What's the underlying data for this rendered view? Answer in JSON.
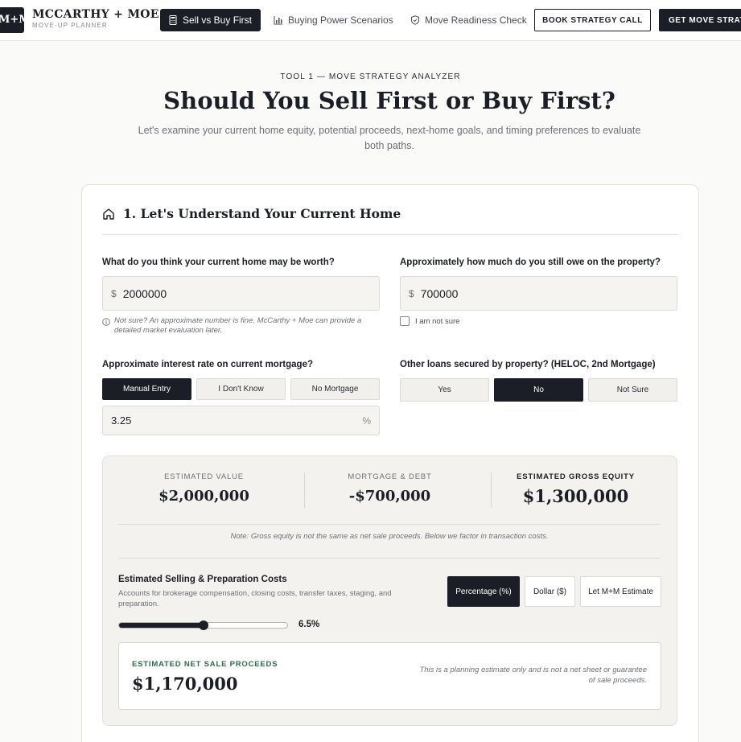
{
  "nav": {
    "logo_mark": "M+M",
    "brand_name": "MCCARTHY + MOE",
    "brand_sub": "MOVE-UP PLANNER",
    "tabs": [
      {
        "label": "Sell vs Buy First",
        "icon": "calculator-icon",
        "active": true
      },
      {
        "label": "Buying Power Scenarios",
        "icon": "bar-chart-icon",
        "active": false
      },
      {
        "label": "Move Readiness Check",
        "icon": "shield-check-icon",
        "active": false
      }
    ],
    "book_call": "BOOK STRATEGY CALL",
    "get_strategy": "GET MOVE STRATEGY"
  },
  "hero": {
    "eyebrow": "TOOL 1 — MOVE STRATEGY ANALYZER",
    "title": "Should You Sell First or Buy First?",
    "subtitle": "Let's examine your current home equity, potential proceeds, next-home goals, and timing preferences to evaluate both paths."
  },
  "section": {
    "title": "1. Let's Understand Your Current Home",
    "home_value": {
      "label": "What do you think your current home may be worth?",
      "currency": "$",
      "value": "2000000",
      "hint": "Not sure? An approximate number is fine. McCarthy + Moe can provide a detailed market evaluation later."
    },
    "owed": {
      "label": "Approximately how much do you still owe on the property?",
      "currency": "$",
      "value": "700000",
      "not_sure": "I am not sure"
    },
    "rate": {
      "label": "Approximate interest rate on current mortgage?",
      "options": [
        "Manual Entry",
        "I Don't Know",
        "No Mortgage"
      ],
      "selected": "Manual Entry",
      "value": "3.25",
      "unit": "%"
    },
    "other_loans": {
      "label": "Other loans secured by property? (HELOC, 2nd Mortgage)",
      "options": [
        "Yes",
        "No",
        "Not Sure"
      ],
      "selected": "No"
    }
  },
  "summary": {
    "estimated_value": {
      "label": "ESTIMATED VALUE",
      "value": "$2,000,000"
    },
    "mortgage_debt": {
      "label": "MORTGAGE & DEBT",
      "value": "-$700,000"
    },
    "gross_equity": {
      "label": "ESTIMATED GROSS EQUITY",
      "value": "$1,300,000"
    },
    "note": "Note: Gross equity is not the same as net sale proceeds. Below we factor in transaction costs.",
    "costs": {
      "title": "Estimated Selling & Preparation Costs",
      "description": "Accounts for brokerage compensation, closing costs, transfer taxes, staging, and preparation.",
      "modes": [
        "Percentage (%)",
        "Dollar ($)",
        "Let M+M Estimate"
      ],
      "selected_mode": "Percentage (%)",
      "slider_fraction": 0.5,
      "value_label": "6.5%"
    },
    "net": {
      "label": "ESTIMATED NET SALE PROCEEDS",
      "value": "$1,170,000",
      "note": "This is a planning estimate only and is not a net sheet or guarantee of sale proceeds."
    }
  }
}
